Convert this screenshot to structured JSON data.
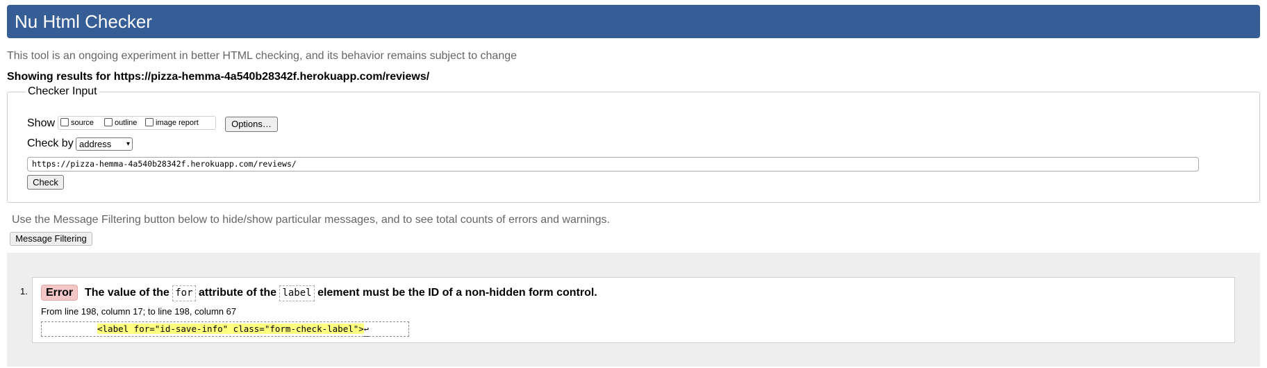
{
  "header": {
    "title": "Nu Html Checker"
  },
  "intro": "This tool is an ongoing experiment in better HTML checking, and its behavior remains subject to change",
  "results_heading": "Showing results for https://pizza-hemma-4a540b28342f.herokuapp.com/reviews/",
  "checker_input": {
    "legend": "Checker Input",
    "show_label": "Show",
    "show_options": [
      "source",
      "outline",
      "image report"
    ],
    "options_button": "Options…",
    "check_by_label": "Check by",
    "check_by_value": "address",
    "url_value": "https://pizza-hemma-4a540b28342f.herokuapp.com/reviews/",
    "check_button": "Check"
  },
  "filter_note": "Use the Message Filtering button below to hide/show particular messages, and to see total counts of errors and warnings.",
  "filter_button": "Message Filtering",
  "messages": [
    {
      "number": "1.",
      "type": "Error",
      "title_parts": [
        "The value of the",
        "for",
        "attribute of the",
        "label",
        "element must be the ID of a non-hidden form control."
      ],
      "location": "From line 198, column 17; to line 198, column 67",
      "extract_highlight": "<label for=\"id-save-info\" class=\"form-check-label\">",
      "extract_return": "↩"
    }
  ],
  "colors": {
    "header_bg": "#365d95",
    "error_badge": "#f4c7c7",
    "highlight": "#ffff80"
  }
}
